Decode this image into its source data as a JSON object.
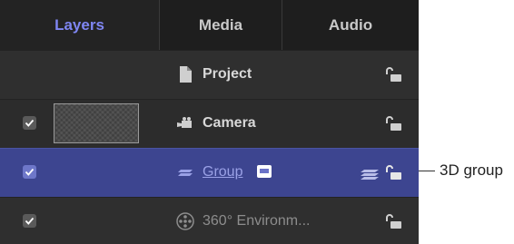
{
  "tabs": [
    {
      "label": "Layers",
      "active": true
    },
    {
      "label": "Media",
      "active": false
    },
    {
      "label": "Audio",
      "active": false
    }
  ],
  "rows": [
    {
      "label": "Project",
      "icon": "document-icon",
      "has_checkbox": false,
      "has_thumbnail": false,
      "checked": false,
      "locked": false
    },
    {
      "label": "Camera",
      "icon": "camera-icon",
      "has_checkbox": true,
      "has_thumbnail": true,
      "checked": true,
      "locked": false
    },
    {
      "label": "Group",
      "icon": "group-layers-icon",
      "has_checkbox": true,
      "has_thumbnail": false,
      "checked": true,
      "selected": true,
      "badge_icon": "rectangle-badge-icon",
      "extra_icon": "3d-group-icon",
      "locked": false
    },
    {
      "label": "360° Environm...",
      "icon": "360-environment-icon",
      "has_checkbox": true,
      "has_thumbnail": false,
      "checked": true,
      "locked": false
    }
  ],
  "callout": {
    "label": "3D group"
  },
  "colors": {
    "panel_bg": "#2c2c2c",
    "tab_bg": "#1e1e1e",
    "active_tab_text": "#7f86f2",
    "selected_row": "#3d4590"
  }
}
